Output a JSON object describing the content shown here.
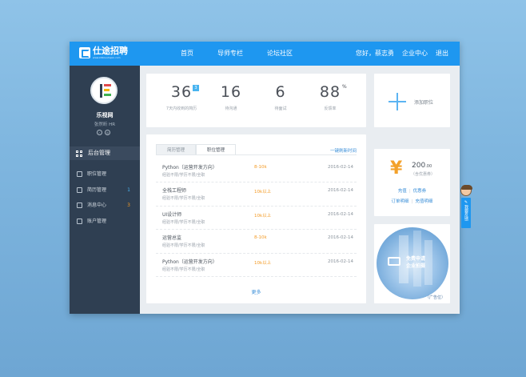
{
  "header": {
    "logo_text": "仕途招聘",
    "logo_sub": "www.shitoushopin.com",
    "nav": [
      "首页",
      "导师专栏",
      "论坛社区"
    ],
    "greeting": "您好，蔡志勇",
    "enterprise_center": "企业中心",
    "logout": "退出"
  },
  "sidebar": {
    "company": "乐视网",
    "person": "张然昕  HR",
    "section_title": "后台管理",
    "items": [
      {
        "label": "职位管理",
        "badge": ""
      },
      {
        "label": "简历管理",
        "badge": "1",
        "badge_color": "#48b4f0"
      },
      {
        "label": "消息中心",
        "badge": "3",
        "badge_color": "#f39a24"
      },
      {
        "label": "账户管理",
        "badge": ""
      }
    ]
  },
  "stats": [
    {
      "value": "36",
      "label": "7天内收到的简历",
      "badge": "3"
    },
    {
      "value": "16",
      "label": "待沟通"
    },
    {
      "value": "6",
      "label": "待面试"
    },
    {
      "value": "88",
      "label": "反馈率",
      "suffix": "%"
    }
  ],
  "add_job": {
    "label": "添加职位"
  },
  "jobs": {
    "tabs": [
      "简历管理",
      "职位管理"
    ],
    "active_tab": 1,
    "refresh": "一键刷新时间",
    "rows": [
      {
        "title": "Python（运营开发方向）",
        "meta": "经验不限/学历不限/全职",
        "salary": "8-10k",
        "date": "2016-02-14"
      },
      {
        "title": "全栈工程师",
        "meta": "经验不限/学历不限/全职",
        "salary": "10k以上",
        "date": "2016-02-14"
      },
      {
        "title": "UI设计师",
        "meta": "经验不限/学历不限/全职",
        "salary": "10k以上",
        "date": "2016-02-14"
      },
      {
        "title": "运营总监",
        "meta": "经验不限/学历不限/全职",
        "salary": "8-10k",
        "date": "2016-02-14"
      },
      {
        "title": "Python（运营开发方向）",
        "meta": "经验不限/学历不限/全职",
        "salary": "10k以上",
        "date": "2016-02-14"
      }
    ],
    "more": "更多"
  },
  "wallet": {
    "currency_icon": "yen-icon",
    "balance": "200",
    "balance_decimals": ".00",
    "note": "（含优惠券）",
    "links": [
      [
        "充值",
        "优惠券"
      ],
      [
        "订单明细",
        "充值明细"
      ]
    ]
  },
  "ad": {
    "line1": "免费申请",
    "line2": "企业拍摄",
    "tag": "（广告位）"
  },
  "feedback": {
    "label": "我要反馈"
  }
}
